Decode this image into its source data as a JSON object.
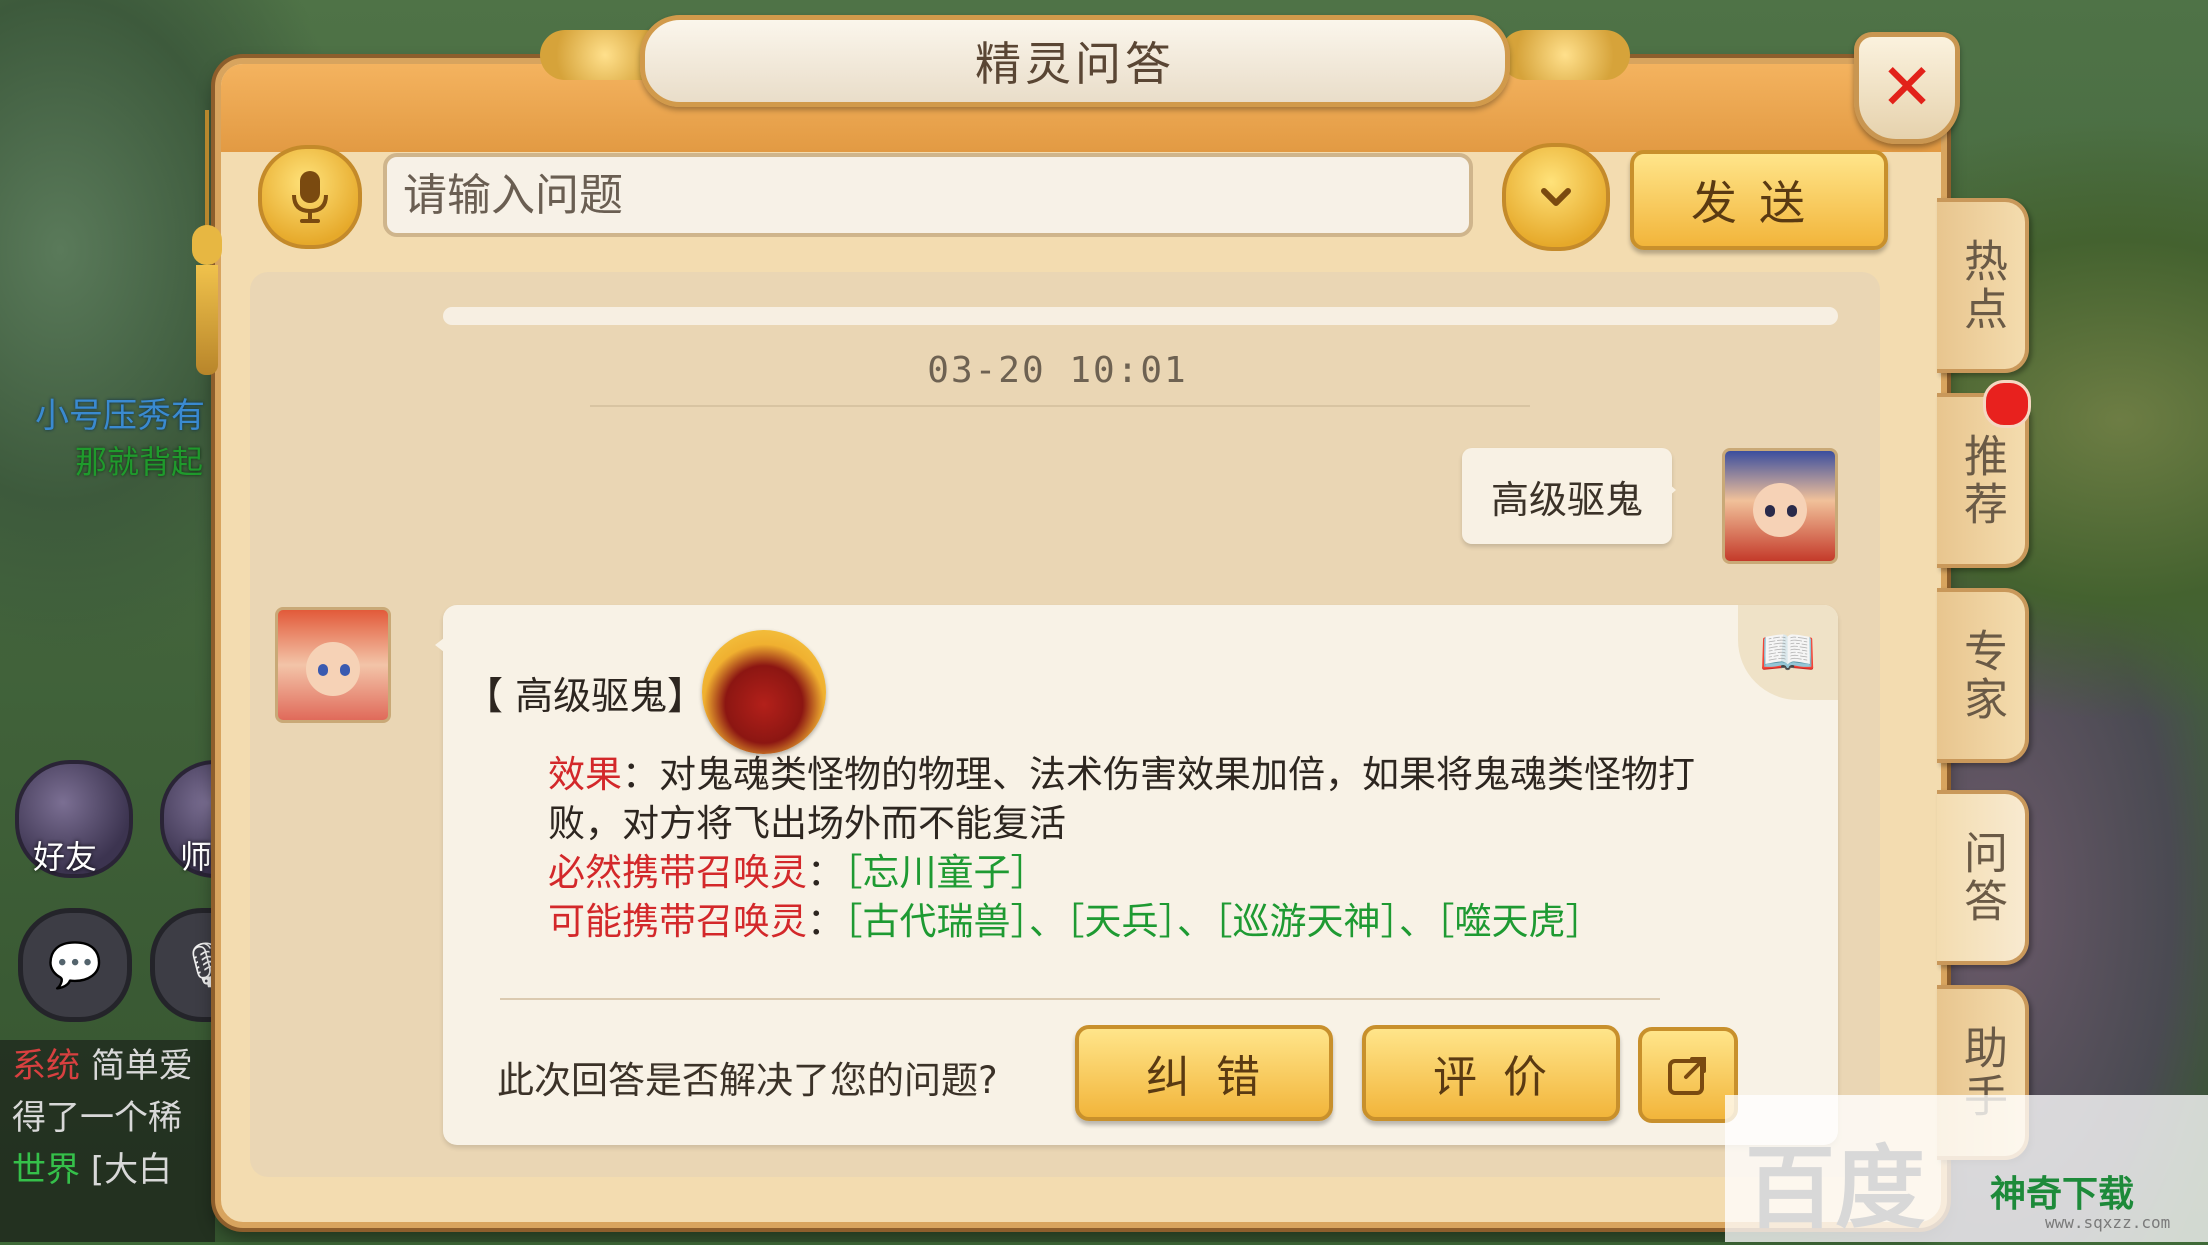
{
  "window": {
    "title": "精灵问答",
    "close_label": "✕"
  },
  "background": {
    "player_name_line1": "小号压秀有",
    "player_name_line2": "那就背起",
    "friends_label": "好友",
    "master_label": "师",
    "chat_log": [
      {
        "tag": "系统",
        "text": "简单爱"
      },
      {
        "tag": "",
        "text": "得了一个稀"
      },
      {
        "tag": "世界",
        "text": "[大白"
      }
    ]
  },
  "input": {
    "placeholder": "请输入问题",
    "value": "",
    "send_label": "发送"
  },
  "chat": {
    "timestamp": "03-20  10:01",
    "user_message": "高级驱鬼",
    "answer": {
      "skill_name": "【 高级驱鬼】",
      "effect_label": "效果",
      "effect_text": "：对鬼魂类怪物的物理、法术伤害效果加倍，如果将鬼魂类怪物打败，对方将飞出场外而不能复活",
      "must_label": "必然携带召唤灵",
      "must_sep": "：",
      "must_items": "［忘川童子］",
      "maybe_label": "可能携带召唤灵",
      "maybe_sep": "：",
      "maybe_items": "［古代瑞兽］、［天兵］、［巡游天神］、［噬天虎］"
    },
    "feedback_question": "此次回答是否解决了您的问题?",
    "correct_label": "纠错",
    "rate_label": "评价"
  },
  "side_tabs": [
    {
      "label": "热点"
    },
    {
      "label": "推荐"
    },
    {
      "label": "专家"
    },
    {
      "label": "问答"
    },
    {
      "label": "助手"
    }
  ],
  "watermark": {
    "baidu": "百度",
    "site_name": "神奇下载",
    "site_url": "www.sqxzz.com"
  },
  "colors": {
    "accent_gold": "#f2b53b",
    "label_red": "#d3282a",
    "item_green": "#1e9a32",
    "close_red": "#e2221a"
  }
}
